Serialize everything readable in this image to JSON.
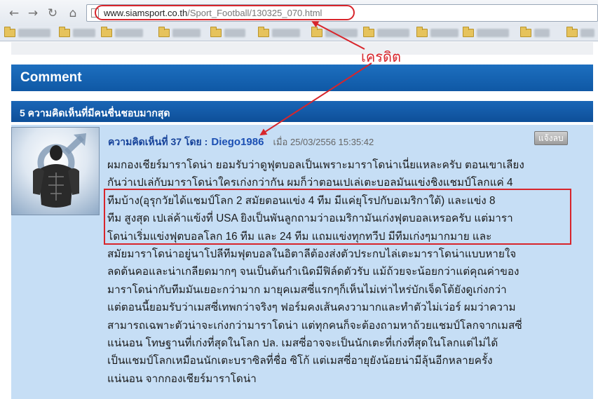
{
  "browser": {
    "url_host": "www.siamsport.co.th",
    "url_path": "/Sport_Football/130325_070.html"
  },
  "page": {
    "comment_header": "Comment",
    "liked_header": "5 ความคิดเห็นที่มีคนชื่นชอบมากสุด"
  },
  "comment": {
    "prefix": "ความคิดเห็นที่ 37 โดย :",
    "username": "Diego1986",
    "timestamp": "เมื่อ 25/03/2556 15:35:42",
    "report_label": "แจ้งลบ",
    "lines": [
      "ผมกองเชียร์มาราโดน่า ยอมรับว่าดูฟุตบอลเป็นเพราะมาราโดน่าเนี่ยแหละครับ ตอนเขาเลียง",
      "กันว่าเปเล่กับมาราโดน่าใครเก่งกว่ากัน ผมก็ว่าตอนเปเล่เตะบอลมันแข่งชิงแชมป์โลกแค่ 4",
      "ทีมบ้าง(อุรุกวัยได้แชมป์โลก 2 สมัยตอนแข่ง 4 ทีม มีแค่ยุโรปกับอเมริกาใต้) และแข่ง 8",
      "ทีม สูงสุด เปเล่ค้าแข้งที่ USA ยิงเป็นพันลูกถามว่าอเมริกามันเก่งฟุตบอลเหรอครับ แต่มารา",
      "โดน่าเริ่มแข่งฟุตบอลโลก 16 ทีม และ 24 ทีม แถมแข่งทุกทวีป มีทีมเก่งๆมากมาย และ",
      "สมัยมาราโดน่าอยู่นาโปลีทีมฟุตบอลในอิตาลีต้องส่งตัวประกบไล่เตะมาราโดน่าแบบหายใจ",
      "ลดต้นคอและน่าเกลียดมากๆ จนเป็นต้นกำเนิดมีฟิล์ดตัวรับ แม้ถ้วยจะน้อยกว่าแต่คุณค่าของ",
      "มาราโดน่ากับทีมมันเยอะกว่ามาก มายุคเมสซี่แรกๆก็เห็นไม่เท่าไหร่บักเจ็ดโต้ยังดูเก่งกว่า",
      "แต่ตอนนี้ยอมรับว่าเมสซี่เทพกว่าจริงๆ ฟอร์มคงเส้นคงวามากและทำตัวไม่เว่อร์ ผมว่าความ",
      "สามารถเฉพาะตัวน่าจะเก่งกว่ามาราโดน่า แต่ทุกคนก็จะต้องถามหาถ้วยแชมป์โลกจากเมสซี่",
      "แน่นอน โทษฐานที่เก่งที่สุดในโลก ปล. เมสซี่อาจจะเป็นนักเตะที่เก่งที่สุดในโลกแต่ไม่ได้",
      "เป็นแชมป์โลกเหมือนนักเตะบราซิลที่ชื่อ ซิโก้ แต่เมสซี่อายุยังน้อยน่ามีลุ้นอีกหลายครั้ง",
      "แน่นอน จากกองเชียร์มาราโดน่า"
    ]
  },
  "annotation": {
    "label": "เครดิต",
    "color": "#d8252b"
  },
  "colors": {
    "header_blue": "#1565b8",
    "card_bg": "#c6def5",
    "username_blue": "#1b4fb3"
  }
}
